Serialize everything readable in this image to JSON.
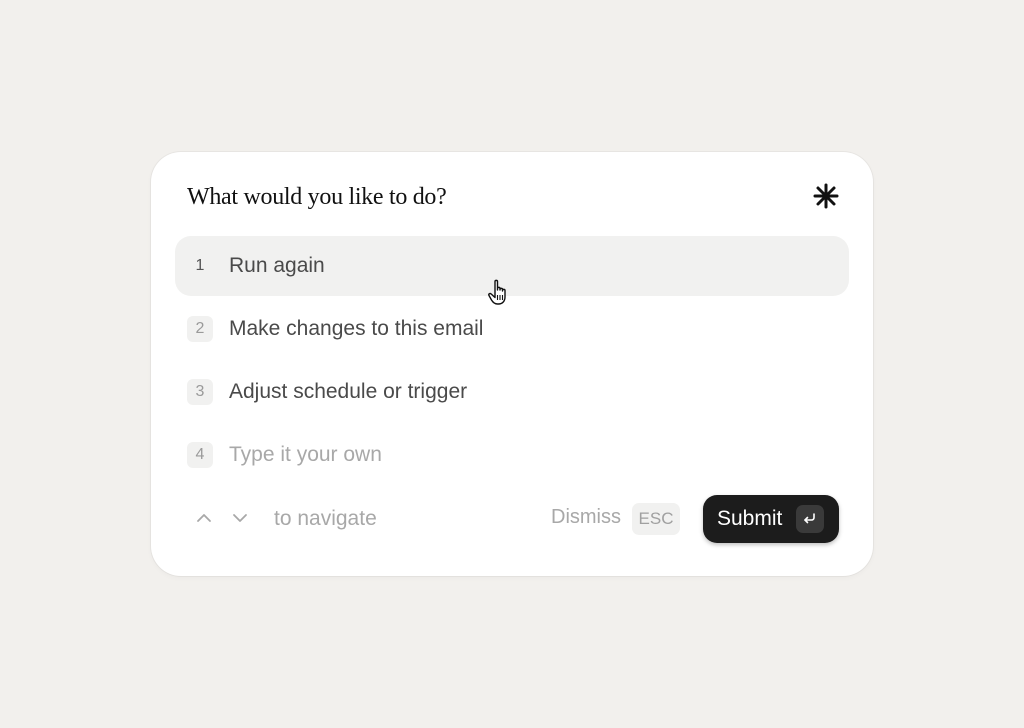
{
  "dialog": {
    "title": "What would you like to do?",
    "options": [
      {
        "number": "1",
        "label": "Run again",
        "active": true
      },
      {
        "number": "2",
        "label": "Make changes to this email",
        "active": false
      },
      {
        "number": "3",
        "label": "Adjust schedule or trigger",
        "active": false
      },
      {
        "number": "4",
        "label": "Type it your own",
        "active": false,
        "placeholder": true
      }
    ]
  },
  "footer": {
    "navigate_text": "to navigate",
    "dismiss_label": "Dismiss",
    "esc_key": "ESC",
    "submit_label": "Submit"
  },
  "icons": {
    "header": "asterisk-spark-icon",
    "cursor": "hand-pointer-icon",
    "nav_up": "chevron-up-icon",
    "nav_down": "chevron-down-icon",
    "enter": "enter-return-icon"
  },
  "colors": {
    "background": "#f2f0ed",
    "card": "#ffffff",
    "active_row": "#f1f1f0",
    "submit_button": "#1c1c1c"
  }
}
